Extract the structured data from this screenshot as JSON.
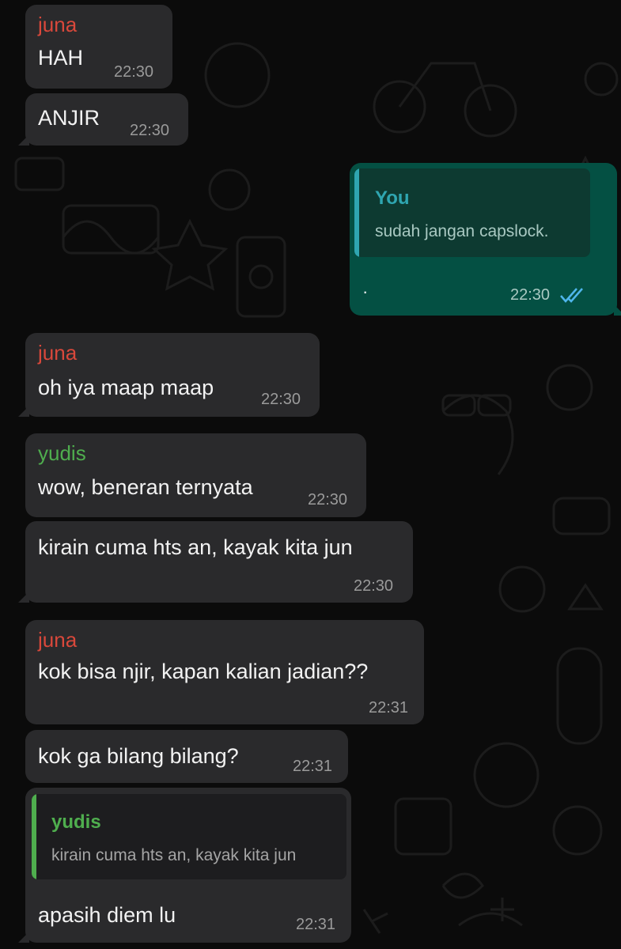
{
  "colors": {
    "juna": "#d9483b",
    "yudis": "#4fae4e",
    "you": "#2fa6b1",
    "read_ticks": "#4fb6ec"
  },
  "messages": [
    {
      "sender": "juna",
      "text": "HAH",
      "time": "22:30"
    },
    {
      "text": "ANJIR",
      "time": "22:30"
    },
    {
      "outgoing": true,
      "quote": {
        "name": "You",
        "text": "sudah jangan capslock."
      },
      "text": "·",
      "time": "22:30",
      "status_icon": "double-check-icon"
    },
    {
      "sender": "juna",
      "text": "oh iya maap maap",
      "time": "22:30"
    },
    {
      "sender": "yudis",
      "text": "wow, beneran ternyata",
      "time": "22:30"
    },
    {
      "text": "kirain cuma hts an, kayak kita jun",
      "time": "22:30"
    },
    {
      "sender": "juna",
      "text": "kok bisa njir, kapan kalian jadian??",
      "time": "22:31"
    },
    {
      "text": "kok ga bilang bilang?",
      "time": "22:31"
    },
    {
      "quote": {
        "name": "yudis",
        "text": "kirain cuma hts an, kayak kita jun"
      },
      "text": "apasih diem lu",
      "time": "22:31"
    }
  ]
}
